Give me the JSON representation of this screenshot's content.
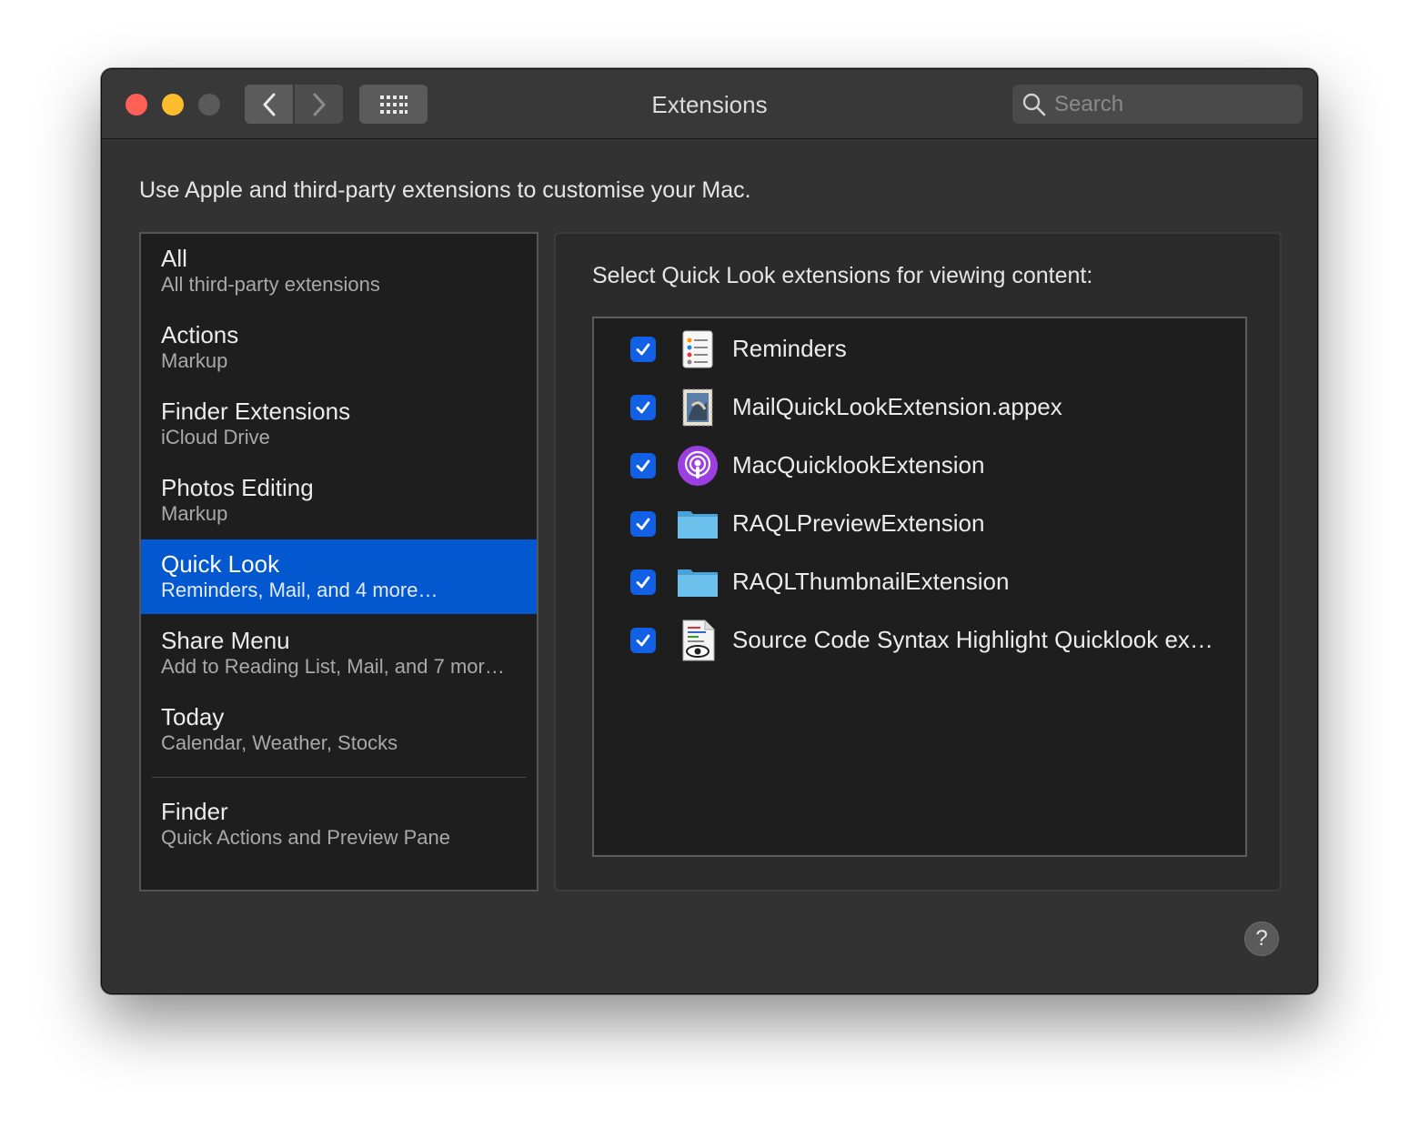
{
  "window": {
    "title": "Extensions",
    "search_placeholder": "Search"
  },
  "intro": "Use Apple and third-party extensions to customise your Mac.",
  "sidebar": {
    "items": [
      {
        "title": "All",
        "subtitle": "All third-party extensions"
      },
      {
        "title": "Actions",
        "subtitle": "Markup"
      },
      {
        "title": "Finder Extensions",
        "subtitle": "iCloud Drive"
      },
      {
        "title": "Photos Editing",
        "subtitle": "Markup"
      },
      {
        "title": "Quick Look",
        "subtitle": "Reminders, Mail, and 4 more…"
      },
      {
        "title": "Share Menu",
        "subtitle": "Add to Reading List, Mail, and 7 mor…"
      },
      {
        "title": "Today",
        "subtitle": "Calendar, Weather, Stocks"
      },
      {
        "title": "Finder",
        "subtitle": "Quick Actions and Preview Pane"
      }
    ],
    "selected": "Quick Look"
  },
  "panel": {
    "header": "Select Quick Look extensions for viewing content:",
    "extensions": [
      {
        "label": "Reminders",
        "checked": true,
        "icon": "reminders-icon"
      },
      {
        "label": "MailQuickLookExtension.appex",
        "checked": true,
        "icon": "mail-stamp-icon"
      },
      {
        "label": "MacQuicklookExtension",
        "checked": true,
        "icon": "podcasts-icon"
      },
      {
        "label": "RAQLPreviewExtension",
        "checked": true,
        "icon": "folder-icon"
      },
      {
        "label": "RAQLThumbnailExtension",
        "checked": true,
        "icon": "folder-icon"
      },
      {
        "label": "Source Code Syntax Highlight Quicklook ex…",
        "checked": true,
        "icon": "source-code-document-icon"
      }
    ]
  },
  "help_label": "?",
  "colors": {
    "selection": "#0358d0",
    "checkbox": "#1260e6",
    "close": "#fe5f57",
    "minimize": "#febc2e"
  }
}
